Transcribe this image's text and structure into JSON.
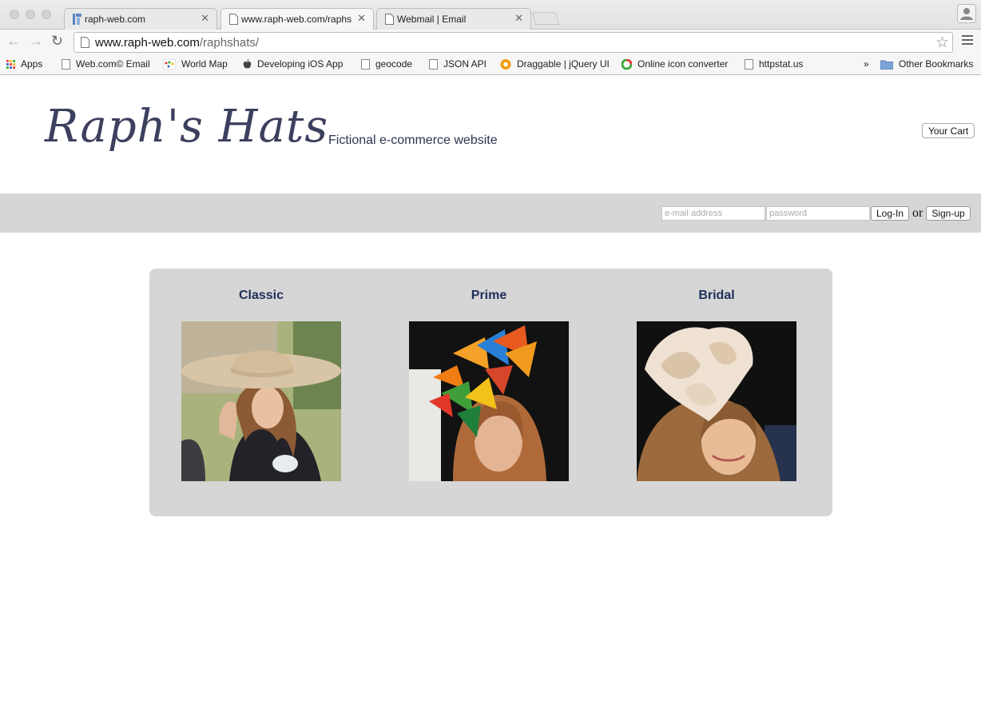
{
  "browser": {
    "tabs": [
      {
        "title": "raph-web.com",
        "active": false
      },
      {
        "title": "www.raph-web.com/raphs",
        "active": true
      },
      {
        "title": "Webmail | Email",
        "active": false
      }
    ],
    "address": {
      "host": "www.raph-web.com",
      "path": "/raphshats/"
    },
    "bookmarks": [
      {
        "label": "Apps",
        "icon": "apps-grid-icon"
      },
      {
        "label": "Web.com© Email",
        "icon": "page-icon"
      },
      {
        "label": "World Map",
        "icon": "world-map-icon"
      },
      {
        "label": "Developing iOS App",
        "icon": "apple-icon"
      },
      {
        "label": "geocode",
        "icon": "page-icon"
      },
      {
        "label": "JSON API",
        "icon": "page-icon"
      },
      {
        "label": "Draggable | jQuery UI",
        "icon": "jquery-ui-icon"
      },
      {
        "label": "Online icon converter",
        "icon": "converter-icon"
      },
      {
        "label": "httpstat.us",
        "icon": "page-icon"
      }
    ],
    "overflow_label": "»",
    "other_bookmarks": "Other Bookmarks"
  },
  "header": {
    "logo": "Raph's Hats",
    "tagline": "Fictional e-commerce website",
    "cart_label": "Your Cart"
  },
  "login": {
    "email_placeholder": "e-mail address",
    "password_placeholder": "password",
    "login_label": "Log-In",
    "or_text": "or",
    "signup_label": "Sign-up"
  },
  "categories": [
    {
      "title": "Classic",
      "image": "woman-in-wide-beige-hat-waving"
    },
    {
      "title": "Prime",
      "image": "woman-with-butterfly-fascinator"
    },
    {
      "title": "Bridal",
      "image": "woman-with-feather-fascinator"
    }
  ],
  "colors": {
    "login_bar": "#d6d6d6",
    "category_panel": "#d6d6d6",
    "category_title": "#1e2f5a",
    "logo": "#3d3f5e"
  }
}
